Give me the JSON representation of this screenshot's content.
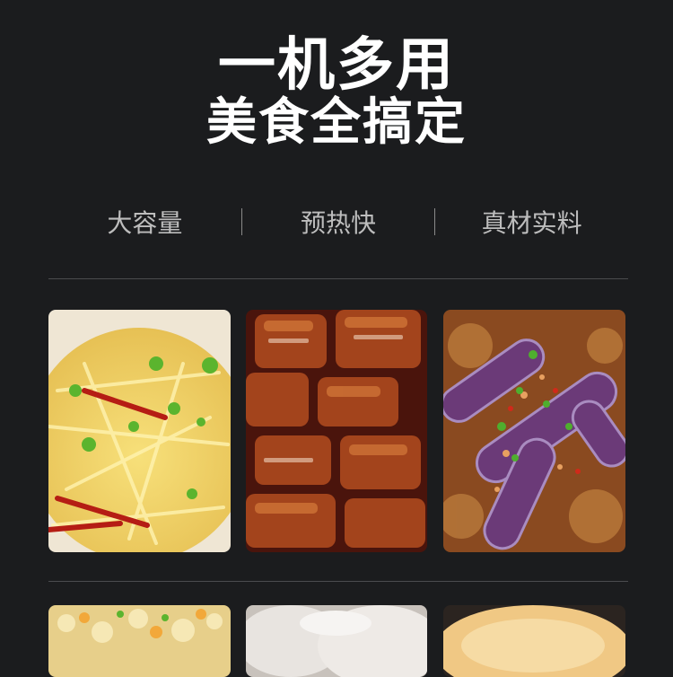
{
  "headline": {
    "line1": "一机多用",
    "line2": "美食全搞定"
  },
  "features": [
    "大容量",
    "预热快",
    "真材实料"
  ],
  "dishes_row1": [
    {
      "icon": "shredded-potato-dish-photo"
    },
    {
      "icon": "braised-pork-dish-photo"
    },
    {
      "icon": "braised-eggplant-dish-photo"
    }
  ],
  "dishes_row2": [
    {
      "icon": "fried-rice-dish-photo"
    },
    {
      "icon": "steamed-buns-dish-photo"
    },
    {
      "icon": "egg-custard-dish-photo"
    }
  ],
  "colors": {
    "background": "#1b1c1e",
    "headline": "#ffffff",
    "feature_text": "#bdbdbd",
    "divider": "#4a4b4e"
  }
}
